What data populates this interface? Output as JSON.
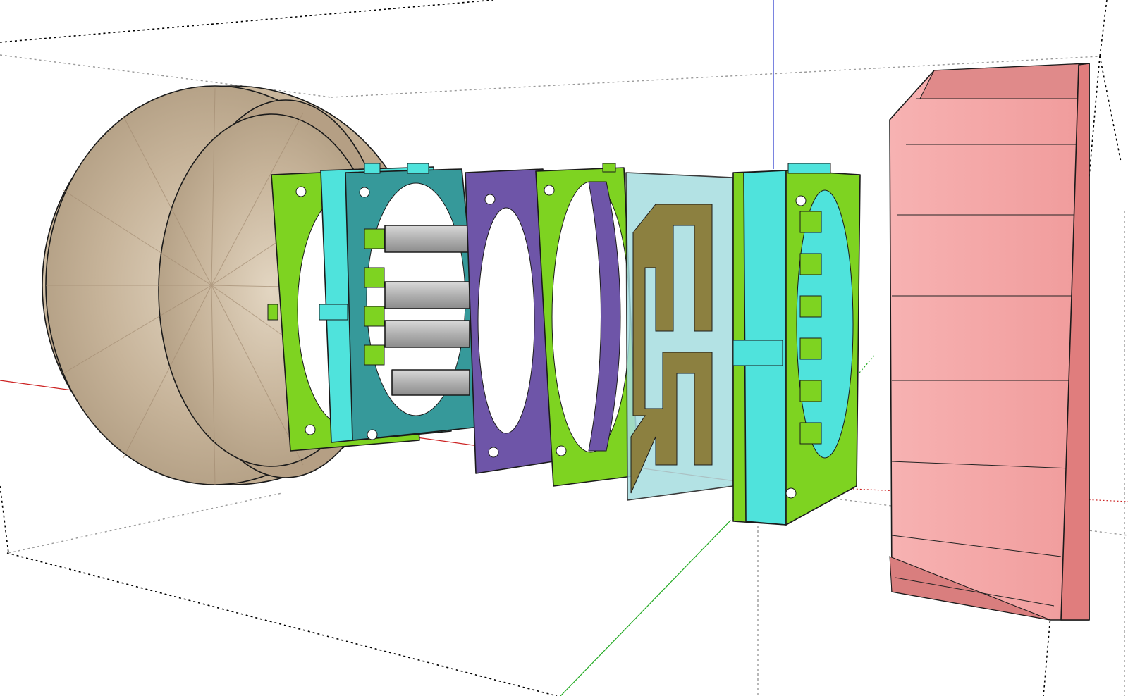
{
  "viewport": {
    "background": "#ffffff",
    "axes": {
      "red": "#cc2222",
      "green": "#22aa22",
      "blue": "#2233cc"
    },
    "guide_line_color": "#000000"
  },
  "model": {
    "parts": [
      {
        "name": "wood-spool",
        "color": "#c8b8a0"
      },
      {
        "name": "green-frame",
        "color": "#7ed321"
      },
      {
        "name": "cyan-frame",
        "color": "#4fe3dc"
      },
      {
        "name": "teal-stator",
        "color": "#36999a"
      },
      {
        "name": "grey-magnets",
        "color": "#a8a8a8"
      },
      {
        "name": "purple-plate",
        "color": "#6e55a8"
      },
      {
        "name": "glass-coil-plate",
        "color": "#a6dde0"
      },
      {
        "name": "olive-coil-trace",
        "color": "#8c8040"
      },
      {
        "name": "pink-rotor",
        "color": "#f3a3a3"
      }
    ]
  }
}
